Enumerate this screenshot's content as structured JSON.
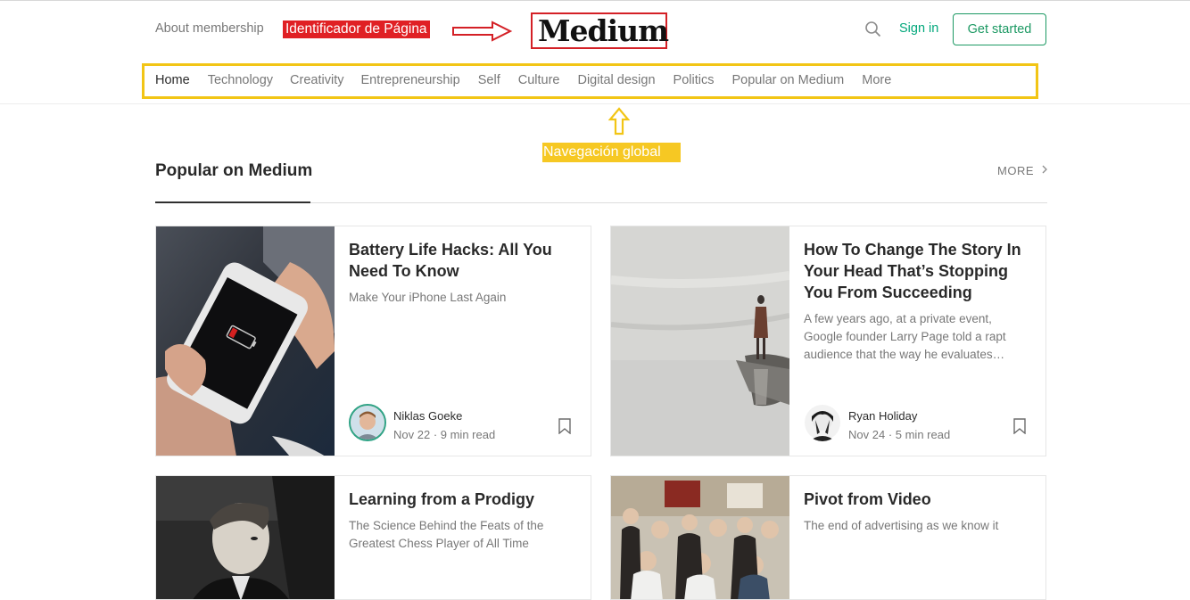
{
  "header": {
    "about_link": "About membership",
    "page_id_annotation": "Identificador de Página",
    "logo": "Medium",
    "sign_in": "Sign in",
    "get_started": "Get started"
  },
  "nav": {
    "items": [
      "Home",
      "Technology",
      "Creativity",
      "Entrepreneurship",
      "Self",
      "Culture",
      "Digital design",
      "Politics",
      "Popular on Medium",
      "More"
    ],
    "annotation": "Navegación global"
  },
  "section": {
    "title": "Popular on Medium",
    "more": "MORE"
  },
  "cards": [
    {
      "title": "Battery Life Hacks: All You Need To Know",
      "subtitle": "Make Your iPhone Last Again",
      "author": "Niklas Goeke",
      "date": "Nov 22",
      "read_time": "9 min read"
    },
    {
      "title": "How To Change The Story In Your Head That’s Stopping You From Succeeding",
      "subtitle": "A few years ago, at a private event, Google founder Larry Page told a rapt audience that the way he evaluates…",
      "author": "Ryan Holiday",
      "date": "Nov 24",
      "read_time": "5 min read"
    },
    {
      "title": "Learning from a Prodigy",
      "subtitle": "The Science Behind the Feats of the Greatest Chess Player of All Time"
    },
    {
      "title": "Pivot from Video",
      "subtitle": "The end of advertising as we know it"
    }
  ],
  "colors": {
    "accent_green": "#1c9963",
    "annotation_red": "#e02024",
    "annotation_yellow": "#f2c515"
  },
  "icons": [
    "search-icon",
    "bookmark-icon",
    "chevron-right-icon",
    "right-arrow-icon",
    "up-arrow-icon"
  ]
}
